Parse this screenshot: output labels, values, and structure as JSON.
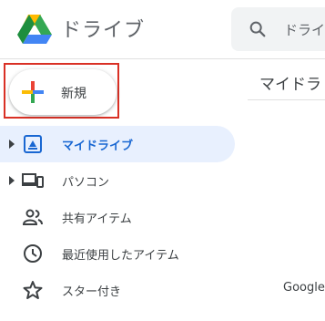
{
  "header": {
    "app_title": "ドライブ",
    "logo_icon": "google-drive-logo",
    "search": {
      "icon": "search-icon",
      "text": "ドライ"
    }
  },
  "new_button": {
    "label": "新規",
    "icon": "plus-icon",
    "highlight_color": "#d93025"
  },
  "sidebar": {
    "items": [
      {
        "label": "マイドライブ",
        "icon": "my-drive-icon",
        "selected": true,
        "expandable": true
      },
      {
        "label": "パソコン",
        "icon": "computers-icon",
        "selected": false,
        "expandable": true
      },
      {
        "label": "共有アイテム",
        "icon": "shared-people-icon",
        "selected": false,
        "expandable": false
      },
      {
        "label": "最近使用したアイテム",
        "icon": "clock-icon",
        "selected": false,
        "expandable": false
      },
      {
        "label": "スター付き",
        "icon": "star-icon",
        "selected": false,
        "expandable": false
      }
    ]
  },
  "main": {
    "title": "マイドラ",
    "owner_text": "Google"
  },
  "colors": {
    "accent": "#1967d2",
    "selected_bg": "#e8f0fe",
    "icon_gray": "#5f6368"
  }
}
